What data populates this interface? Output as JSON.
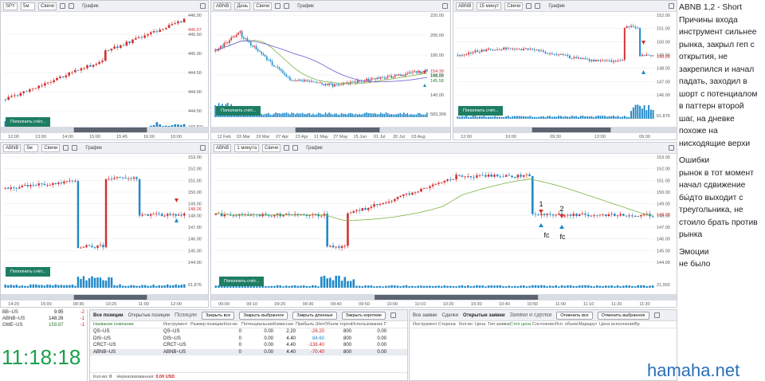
{
  "charts": {
    "spy": {
      "symbol": "SPY",
      "interval": "5м",
      "style": "Свечи",
      "mode": "График",
      "prices": [
        "446.00",
        "445.50",
        "445.00",
        "444.50",
        "444.00",
        "444.50"
      ],
      "last_price": "445.57",
      "times": [
        "12:00",
        "13:00",
        "14:00",
        "15:00",
        "15:45",
        "16:00",
        "10:00"
      ],
      "fill_button": "Пополнить счёт...",
      "volume_label": "183,811"
    },
    "abnb_day": {
      "symbol": "ABNB",
      "interval": "День",
      "style": "Свечи",
      "mode": "График",
      "prices": [
        "220.00",
        "200.00",
        "180.00",
        "160.00",
        "140.00"
      ],
      "last_prices": [
        "154.39",
        "148.26",
        "145.58"
      ],
      "dates": [
        "12 Feb",
        "03 Mar",
        "19 Mar",
        "07 Apr",
        "23 Apr",
        "11 May",
        "27 May",
        "15 Jun",
        "01 Jul",
        "20 Jul",
        "03 Aug"
      ],
      "fill_button": "Пополнить счёт...",
      "volume_label": "583,306"
    },
    "abnb_15m": {
      "symbol": "ABNB",
      "interval": "15 минут",
      "style": "Свечи",
      "mode": "График",
      "prices": [
        "152.00",
        "151.00",
        "150.00",
        "149.00",
        "148.00",
        "147.00",
        "146.00"
      ],
      "last_price": "148.26",
      "times": [
        "12:00",
        "10:00",
        "09:30",
        "12:00",
        "09:30"
      ],
      "fill_button": "Пополнить счёт...",
      "volume_label": "61,876"
    },
    "abnb_5m": {
      "symbol": "ABNB",
      "interval": "5м",
      "style": "Свечи",
      "mode": "График",
      "prices": [
        "153.00",
        "152.00",
        "151.00",
        "150.00",
        "149.00",
        "148.00",
        "147.00",
        "146.00",
        "145.00",
        "144.00"
      ],
      "last_price": "148.26",
      "times": [
        "14:20",
        "15:00",
        "09:30",
        "10:20",
        "11:00",
        "12:00"
      ],
      "fill_button": "Пополнить счёт...",
      "volume_label": "61,876"
    },
    "abnb_1m": {
      "symbol": "ABNB",
      "interval": "1 минута",
      "style": "Свечи",
      "mode": "График",
      "prices": [
        "153.00",
        "152.00",
        "151.00",
        "150.00",
        "149.00",
        "148.00",
        "147.00",
        "146.00",
        "145.00",
        "144.00"
      ],
      "last_price": "148.30",
      "times": [
        "09:00",
        "09:10",
        "09:20",
        "09:30",
        "09:40",
        "09:50",
        "10:00",
        "10:10",
        "10:20",
        "10:30",
        "10:40",
        "10:50",
        "11:00",
        "11:10",
        "11:20",
        "11:30"
      ],
      "fill_button": "Пополнить счёт...",
      "volume_label": "21,902",
      "marks": {
        "first": "1",
        "second": "2",
        "fc": "fc"
      }
    }
  },
  "watchlist": [
    {
      "symbol": "BB~US",
      "price": "9.95",
      "change": "-2"
    },
    {
      "symbol": "ABNB~US",
      "price": "148.26",
      "change": "-1"
    },
    {
      "symbol": "GME~US",
      "price": "159.87",
      "change": "-1"
    },
    {
      "symbol": "",
      "price": "",
      "change": ""
    }
  ],
  "clock": "11:18:18",
  "positions": {
    "title": "Позиции",
    "tabs": [
      "Все позиции",
      "Открытые позиции"
    ],
    "buttons": [
      "Закрыть все",
      "Закрыть выбранное",
      "Закрыть длинные",
      "Закрыть короткие"
    ],
    "columns": [
      "Название компании",
      "Инструмент",
      "Размер позиции",
      "Кол-во",
      "Потенциальная",
      "Комиссии",
      "Прибыль (Нет)",
      "Объем торгов",
      "Использование ПС"
    ],
    "rows": [
      {
        "name": "QS~US",
        "instrument": "QS~US",
        "size": "",
        "qty": "0",
        "potential": "0.00",
        "fee": "2.20",
        "pnl": "-26.20",
        "volume": "800",
        "usage": "0.00"
      },
      {
        "name": "DIS~US",
        "instrument": "DIS~US",
        "size": "",
        "qty": "0",
        "potential": "0.00",
        "fee": "4.40",
        "pnl": "84.60",
        "volume": "800",
        "usage": "0.00"
      },
      {
        "name": "CRCT~US",
        "instrument": "CRCT~US",
        "size": "",
        "qty": "0",
        "potential": "0.00",
        "fee": "4.40",
        "pnl": "-138.40",
        "volume": "800",
        "usage": "0.00"
      },
      {
        "name": "ABNB~US",
        "instrument": "ABNB~US",
        "size": "",
        "qty": "0",
        "potential": "0.00",
        "fee": "4.40",
        "pnl": "-70.40",
        "volume": "800",
        "usage": "0.00"
      }
    ],
    "footer_qty_label": "Кол-во:",
    "footer_qty": "0",
    "footer_unrealized_label": "Нереализованная:",
    "footer_unrealized": "0.00 USD"
  },
  "orders": {
    "title": "Заявки и сделки",
    "tabs": [
      "Все заявки",
      "Сделки",
      "Открытые заявки"
    ],
    "buttons": [
      "Отменить все",
      "Отменить выбранное"
    ],
    "columns": [
      "Инструмент",
      "Сторона",
      "Кол-во",
      "Цена",
      "Тип заявки",
      "Стоп цена",
      "Состояние",
      "Исп. объем",
      "Маршрут",
      "Цена исполнения",
      "Вр"
    ]
  },
  "notes": {
    "heading": "ABNB 1,2 - Short",
    "reasons_lines": [
      "Причины входа",
      "инструмент сильнее",
      "рынка, закрыл геп с",
      "открытия, не",
      "закрепился и начал",
      "падать, заходил в",
      "шорт с потенциалом",
      "в паттерн второй",
      "шаг, на дневке",
      "похоже на",
      "нисходящие верхи"
    ],
    "errors_lines": [
      "Ошибки",
      "рынок в тот момент",
      "начал сдвижение",
      "бы́дто выходит с",
      "треугольника, не",
      "стоило брать против",
      "рынка"
    ],
    "emotions_lines": [
      "Эмоции",
      "не было"
    ]
  },
  "brand": "hamaha.net",
  "colors": {
    "up": "#1e88c8",
    "down": "#d32f2f",
    "ma_green": "#7cb342",
    "ma_purple": "#6a5acd",
    "fill": "#1e7e63",
    "clock": "#19a04a"
  }
}
